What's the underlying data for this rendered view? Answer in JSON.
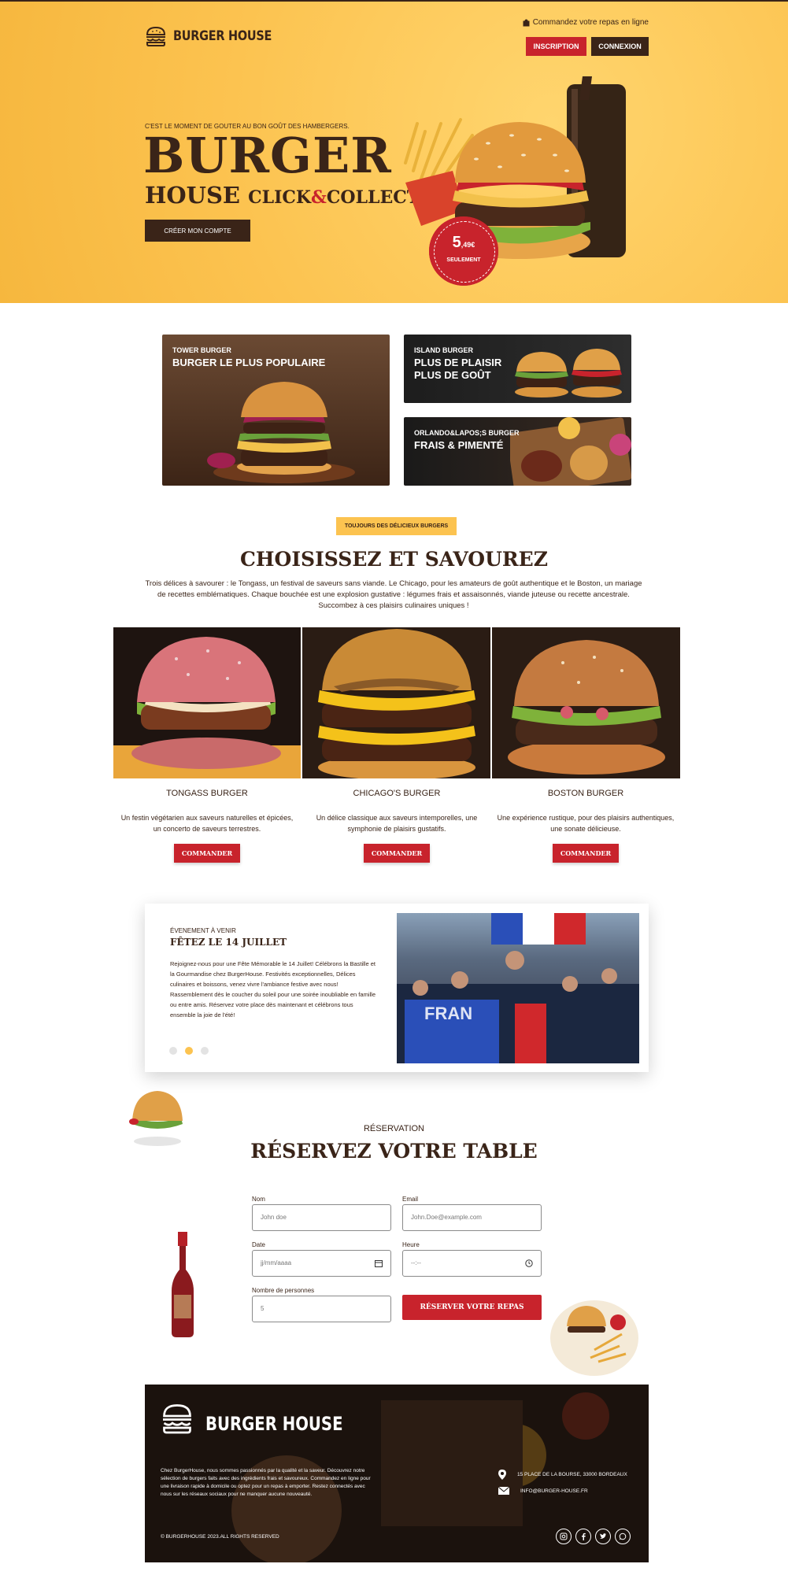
{
  "header": {
    "brand": "BURGER HOUSE",
    "order_online": "Commandez votre repas en ligne",
    "signup_label": "INSCRIPTION",
    "login_label": "CONNEXION"
  },
  "hero": {
    "tagline": "C'EST LE MOMENT DE GOUTER AU BON GOÛT DES HAMBERGERS.",
    "title_line1": "BURGER",
    "title_house": "HOUSE",
    "title_click": "CLICK",
    "title_amp": "&",
    "title_collect": "COLLECT",
    "cta_label": "CRÉER MON COMPTE",
    "price_main": "5",
    "price_cents": ",49€",
    "price_sub": "SEULEMENT"
  },
  "promos": [
    {
      "sup": "TOWER BURGER",
      "main": "BURGER LE PLUS POPULAIRE"
    },
    {
      "sup": "ISLAND BURGER",
      "main_line1": "PLUS DE PLAISIR",
      "main_line2": "PLUS DE GOÛT"
    },
    {
      "sup": "ORLANDO&LAPOS;S BURGER",
      "main": "FRAIS & PIMENTÉ"
    }
  ],
  "menu": {
    "badge": "TOUJOURS DES DÉLICIEUX BURGERS",
    "title": "CHOISISSEZ ET SAVOUREZ",
    "description": "Trois délices à savourer : le Tongass, un festival de saveurs sans viande. Le Chicago, pour les amateurs de goût authentique et le Boston, un mariage de recettes emblématiques. Chaque bouchée est une explosion gustative : légumes frais et assaisonnés, viande juteuse ou recette ancestrale. Succombez à ces plaisirs culinaires uniques !",
    "items": [
      {
        "name": "TONGASS BURGER",
        "desc": "Un festin végétarien aux saveurs naturelles et épicées, un concerto de saveurs terrestres.",
        "button": "COMMANDER"
      },
      {
        "name": "CHICAGO'S BURGER",
        "desc": "Un délice classique aux saveurs intemporelles, une symphonie de plaisirs gustatifs.",
        "button": "COMMANDER"
      },
      {
        "name": "BOSTON BURGER",
        "desc": "Une expérience rustique, pour des plaisirs authentiques, une sonate délicieuse.",
        "button": "COMMANDER"
      }
    ]
  },
  "event": {
    "kicker": "ÉVENEMENT À VENIR",
    "title": "FÊTEZ LE 14 JUILLET",
    "text": "Rejoignez-nous pour une Fête Mémorable le 14 Juillet! Célébrons la Bastille et la Gourmandise chez BurgerHouse. Festivités exceptionnelles, Délices culinaires et boissons, venez vivre l'ambiance festive avec nous! Rassemblement dès le coucher du soleil pour une soirée inoubliable en famille ou entre amis. Réservez votre place dès maintenant et célébrons tous ensemble la joie de l'été!",
    "image_text": "FRAN",
    "active_dot": 1,
    "dot_color_active": "#fcc350"
  },
  "reservation": {
    "kicker": "RÉSERVATION",
    "title": "RÉSERVEZ VOTRE TABLE",
    "name_label": "Nom",
    "name_placeholder": "John doe",
    "email_label": "Email",
    "email_placeholder": "John.Doe@example.com",
    "date_label": "Date",
    "date_placeholder": "jj/mm/aaaa",
    "time_label": "Heure",
    "time_placeholder": "--:--",
    "people_label": "Nombre de personnes",
    "people_value": "5",
    "submit_label": "RÉSERVER VOTRE REPAS"
  },
  "footer": {
    "brand": "BURGER HOUSE",
    "about": "Chez BurgerHouse, nous sommes passionnés par la qualité et la saveur. Découvrez notre sélection de burgers faits avec des ingrédients frais et savoureux. Commandez en ligne pour une livraison rapide à domicile ou optez pour un repas à emporter. Restez connectés avec nous sur les réseaux sociaux pour ne manquer aucune nouveauté.",
    "copyright": "© BURGERHOUSE 2023.ALL RIGHTS RESERVED",
    "address": "15 PLACE DE LA BOURSE, 33000 BORDEAUX",
    "email": "INFO@BURGER-HOUSE.FR",
    "socials": [
      "instagram-icon",
      "facebook-icon",
      "twitter-icon",
      "whatsapp-icon"
    ]
  },
  "colors": {
    "brand_yellow": "#fcc350",
    "brand_red": "#c8232c",
    "brand_brown": "#3a2418"
  }
}
